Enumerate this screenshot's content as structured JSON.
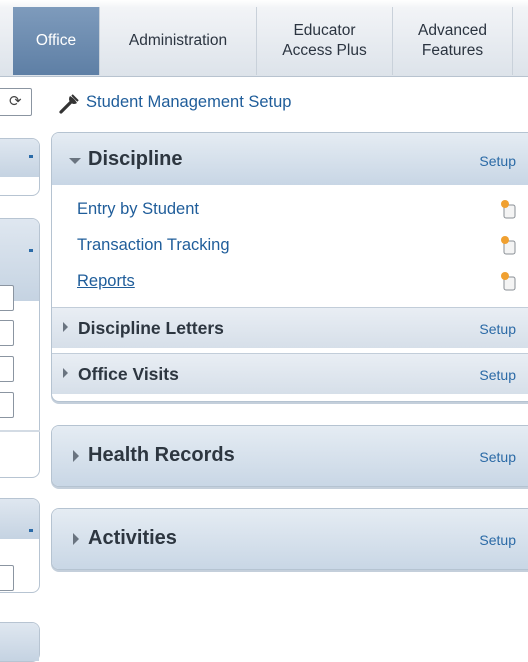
{
  "tabs": [
    {
      "label": "Office",
      "active": true
    },
    {
      "label": "Administration",
      "active": false
    },
    {
      "label": "Educator Access Plus",
      "active": false
    },
    {
      "label": "Advanced Features",
      "active": false
    }
  ],
  "breadcrumb": {
    "icon": "wrench-icon",
    "label": "Student Management Setup"
  },
  "cards": {
    "discipline": {
      "title": "Discipline",
      "setup": "Setup",
      "items": [
        {
          "label": "Entry by Student"
        },
        {
          "label": "Transaction Tracking"
        },
        {
          "label": "Reports"
        }
      ],
      "subsections": [
        {
          "title": "Discipline Letters",
          "setup": "Setup"
        },
        {
          "title": "Office Visits",
          "setup": "Setup"
        }
      ]
    },
    "health": {
      "title": "Health Records",
      "setup": "Setup"
    },
    "activities": {
      "title": "Activities",
      "setup": "Setup"
    }
  },
  "colors": {
    "active_tab": "#6d8db2",
    "link": "#1f5d9a",
    "panel_header": "#c8d6e5",
    "panel_border": "#b5c3d1"
  }
}
